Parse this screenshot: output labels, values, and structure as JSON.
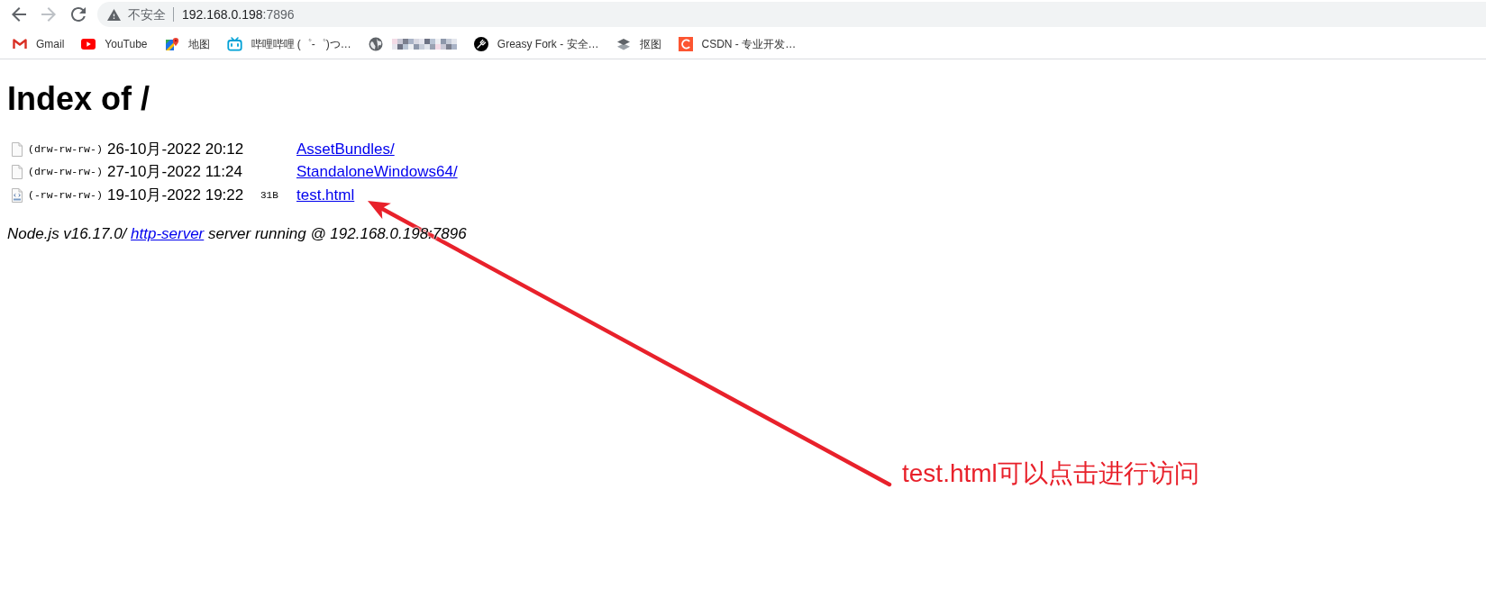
{
  "toolbar": {
    "nav_buttons": [
      {
        "kind": "back",
        "disabled": false
      },
      {
        "kind": "forward",
        "disabled": true
      },
      {
        "kind": "reload",
        "disabled": false
      }
    ],
    "security_label": "不安全",
    "url_host": "192.168.0.198",
    "url_port": ":7896"
  },
  "bookmarks": [
    {
      "kind": "gmail",
      "label": "Gmail"
    },
    {
      "kind": "youtube",
      "label": "YouTube"
    },
    {
      "kind": "maps",
      "label": "地图"
    },
    {
      "kind": "bilibili",
      "label": "哔哩哔哩 (゜-゜)つ…"
    },
    {
      "kind": "blurred"
    },
    {
      "kind": "greasyfork",
      "label": "Greasy Fork - 安全…"
    },
    {
      "kind": "layers",
      "label": "抠图"
    },
    {
      "kind": "csdn",
      "label": "CSDN - 专业开发…"
    }
  ],
  "page": {
    "heading": "Index of /",
    "entries": [
      {
        "kind": "blank",
        "permissions": "(drw-rw-rw-)",
        "modified": "26-10月-2022 20:12",
        "name": "AssetBundles/"
      },
      {
        "kind": "blank",
        "permissions": "(drw-rw-rw-)",
        "modified": "27-10月-2022 11:24",
        "name": "StandaloneWindows64/"
      },
      {
        "kind": "html",
        "permissions": "(-rw-rw-rw-)",
        "modified": "19-10月-2022 19:22",
        "size": "31B",
        "name": "test.html"
      }
    ],
    "footer": {
      "server": "Node.js v16.17.0/",
      "link": "http-server",
      "rest": "server running @ 192.168.0.198:7896"
    }
  },
  "annotation": {
    "text": "test.html可以点击进行访问"
  }
}
